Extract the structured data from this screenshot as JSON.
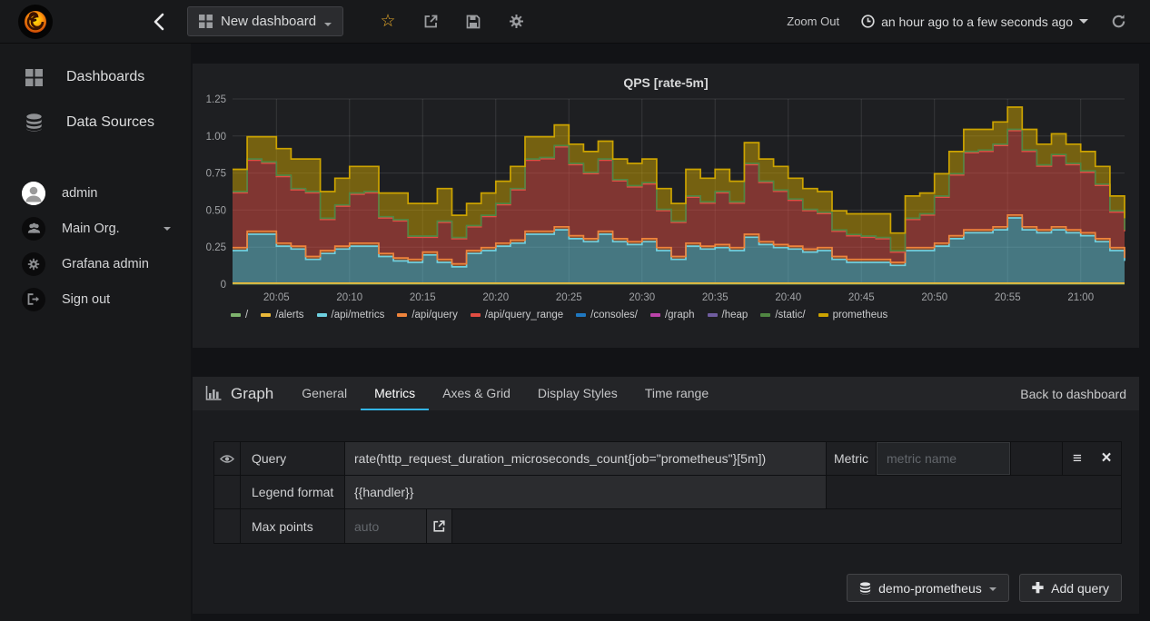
{
  "navbar": {
    "dashboard_title": "New dashboard",
    "zoom_out_label": "Zoom Out",
    "time_range_label": "an hour ago to a few seconds ago"
  },
  "sidebar": {
    "items": [
      {
        "label": "Dashboards",
        "icon": "grid-icon"
      },
      {
        "label": "Data Sources",
        "icon": "database-icon"
      }
    ],
    "account": [
      {
        "label": "admin",
        "icon": "avatar"
      },
      {
        "label": "Main Org.",
        "icon": "users-icon"
      },
      {
        "label": "Grafana admin",
        "icon": "gear-icon"
      },
      {
        "label": "Sign out",
        "icon": "sign-out-icon"
      }
    ]
  },
  "panel": {
    "title": "QPS [rate-5m]"
  },
  "chart_data": {
    "type": "area",
    "stacked": true,
    "line_interpolation": "step-after",
    "title": "QPS [rate-5m]",
    "ylim": [
      0,
      1.25
    ],
    "y_tick_labels": [
      "0",
      "0.25",
      "0.50",
      "0.75",
      "1.00",
      "1.25"
    ],
    "x_ticks": [
      "20:05",
      "20:10",
      "20:15",
      "20:20",
      "20:25",
      "20:30",
      "20:35",
      "20:40",
      "20:45",
      "20:50",
      "20:55",
      "21:00"
    ],
    "x_tick_start_index": 3,
    "x_tick_index_step": 5,
    "x_domain": [
      "20:02",
      "21:03"
    ],
    "step_minutes": 1,
    "grid": true,
    "legend_position": "bottom",
    "series": [
      {
        "name": "/",
        "color": "#7EB26D",
        "constant": 0.003
      },
      {
        "name": "/alerts",
        "color": "#EAB839",
        "constant": 0.004
      },
      {
        "name": "/api/metrics",
        "color": "#6ED0E0",
        "values": [
          0.22,
          0.33,
          0.33,
          0.25,
          0.23,
          0.16,
          0.2,
          0.23,
          0.25,
          0.25,
          0.18,
          0.15,
          0.14,
          0.19,
          0.14,
          0.11,
          0.2,
          0.22,
          0.25,
          0.27,
          0.33,
          0.33,
          0.36,
          0.3,
          0.28,
          0.33,
          0.28,
          0.26,
          0.28,
          0.22,
          0.16,
          0.25,
          0.23,
          0.24,
          0.22,
          0.31,
          0.26,
          0.24,
          0.23,
          0.21,
          0.22,
          0.16,
          0.14,
          0.14,
          0.14,
          0.12,
          0.22,
          0.22,
          0.25,
          0.3,
          0.34,
          0.34,
          0.36,
          0.44,
          0.36,
          0.34,
          0.36,
          0.34,
          0.32,
          0.28,
          0.22,
          0.15
        ]
      },
      {
        "name": "/api/query",
        "color": "#EF843C",
        "constant": 0.02
      },
      {
        "name": "/api/query_range",
        "color": "#E24D42",
        "values": [
          0.37,
          0.48,
          0.46,
          0.45,
          0.38,
          0.43,
          0.21,
          0.27,
          0.33,
          0.34,
          0.24,
          0.25,
          0.15,
          0.1,
          0.25,
          0.17,
          0.16,
          0.21,
          0.26,
          0.34,
          0.48,
          0.49,
          0.54,
          0.48,
          0.44,
          0.48,
          0.39,
          0.37,
          0.37,
          0.25,
          0.23,
          0.31,
          0.29,
          0.35,
          0.3,
          0.47,
          0.4,
          0.36,
          0.31,
          0.26,
          0.23,
          0.17,
          0.16,
          0.15,
          0.14,
          0.07,
          0.19,
          0.22,
          0.31,
          0.41,
          0.52,
          0.53,
          0.55,
          0.57,
          0.51,
          0.43,
          0.48,
          0.44,
          0.41,
          0.36,
          0.24,
          0.18
        ]
      },
      {
        "name": "/consoles/",
        "color": "#1F78C1",
        "constant": 0
      },
      {
        "name": "/graph",
        "color": "#BA43A9",
        "constant": 0
      },
      {
        "name": "/heap",
        "color": "#705DA0",
        "constant": 0
      },
      {
        "name": "/static/",
        "color": "#508642",
        "constant": 0.008
      },
      {
        "name": "prometheus",
        "color": "#CCA300",
        "values": [
          0.15,
          0.15,
          0.17,
          0.18,
          0.2,
          0.22,
          0.18,
          0.18,
          0.18,
          0.17,
          0.16,
          0.18,
          0.22,
          0.22,
          0.22,
          0.15,
          0.15,
          0.15,
          0.15,
          0.15,
          0.15,
          0.14,
          0.14,
          0.13,
          0.14,
          0.12,
          0.14,
          0.15,
          0.16,
          0.14,
          0.12,
          0.18,
          0.16,
          0.15,
          0.14,
          0.14,
          0.15,
          0.16,
          0.14,
          0.14,
          0.14,
          0.13,
          0.14,
          0.15,
          0.16,
          0.12,
          0.15,
          0.14,
          0.15,
          0.15,
          0.15,
          0.14,
          0.15,
          0.15,
          0.14,
          0.14,
          0.14,
          0.13,
          0.13,
          0.12,
          0.1,
          0.08
        ]
      }
    ]
  },
  "editor": {
    "panel_title": "Graph",
    "tabs": [
      "General",
      "Metrics",
      "Axes & Grid",
      "Display Styles",
      "Time range"
    ],
    "active_tab": "Metrics",
    "back_link": "Back to dashboard",
    "query_row": {
      "label": "Query",
      "value": "rate(http_request_duration_microseconds_count{job=\"prometheus\"}[5m])",
      "metric_label": "Metric",
      "metric_placeholder": "metric name"
    },
    "legend_row": {
      "label": "Legend format",
      "value": "{{handler}}"
    },
    "maxpoints_row": {
      "label": "Max points",
      "placeholder": "auto"
    },
    "datasource_button": "demo-prometheus",
    "add_query_button": "Add query"
  },
  "colors": {
    "active_tab_underline": "#33b5e5",
    "star": "#e5a829",
    "panel_background": "#1e1f22"
  }
}
